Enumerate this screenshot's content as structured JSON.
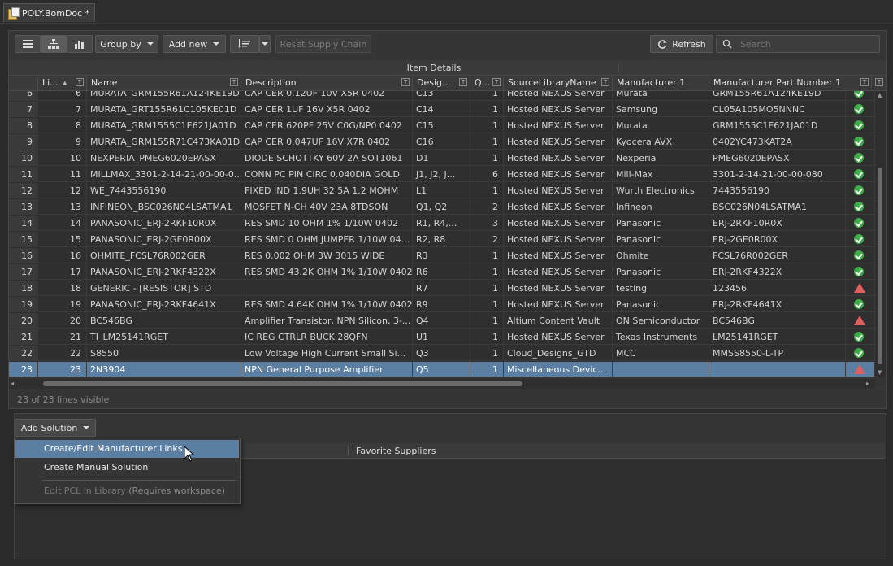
{
  "tab": {
    "title": "POLY.BomDoc *"
  },
  "toolbar": {
    "group_by": "Group by",
    "add_new": "Add new",
    "reset_supply_chain": "Reset Supply Chain",
    "refresh": "Refresh",
    "search_placeholder": "Search"
  },
  "grid": {
    "group_header": "Item Details",
    "columns": [
      "Li...",
      "Name",
      "Description",
      "Desig...",
      "Q...",
      "SourceLibraryName",
      "Manufacturer 1",
      "Manufacturer Part Number 1"
    ],
    "rows": [
      {
        "rn": "6",
        "line": "6",
        "name": "MURATA_GRM155R61A124KE19D",
        "desc": "CAP CER 0.12UF 10V X5R 0402",
        "des": "C13",
        "qty": "1",
        "src": "Hosted NEXUS Server",
        "mfr": "Murata",
        "mpn": "GRM155R61A124KE19D",
        "status": "ok"
      },
      {
        "rn": "7",
        "line": "7",
        "name": "MURATA_GRT155R61C105KE01D",
        "desc": "CAP CER 1UF 16V X5R 0402",
        "des": "C14",
        "qty": "1",
        "src": "Hosted NEXUS Server",
        "mfr": "Samsung",
        "mpn": "CL05A105MO5NNNC",
        "status": "ok"
      },
      {
        "rn": "8",
        "line": "8",
        "name": "MURATA_GRM1555C1E621JA01D",
        "desc": "CAP CER 620PF 25V C0G/NP0 0402",
        "des": "C15",
        "qty": "1",
        "src": "Hosted NEXUS Server",
        "mfr": "Murata",
        "mpn": "GRM1555C1E621JA01D",
        "status": "ok"
      },
      {
        "rn": "9",
        "line": "9",
        "name": "MURATA_GRM155R71C473KA01D",
        "desc": "CAP CER 0.047UF 16V X7R 0402",
        "des": "C16",
        "qty": "1",
        "src": "Hosted NEXUS Server",
        "mfr": "Kyocera AVX",
        "mpn": "0402YC473KAT2A",
        "status": "ok"
      },
      {
        "rn": "10",
        "line": "10",
        "name": "NEXPERIA_PMEG6020EPASX",
        "desc": "DIODE SCHOTTKY 60V 2A SOT1061",
        "des": "D1",
        "qty": "1",
        "src": "Hosted NEXUS Server",
        "mfr": "Nexperia",
        "mpn": "PMEG6020EPASX",
        "status": "ok"
      },
      {
        "rn": "11",
        "line": "11",
        "name": "MILLMAX_3301-2-14-21-00-00-0...",
        "desc": "CONN PC PIN CIRC 0.040DIA GOLD",
        "des": "J1, J2, J...",
        "qty": "6",
        "src": "Hosted NEXUS Server",
        "mfr": "Mill-Max",
        "mpn": "3301-2-14-21-00-00-080",
        "status": "ok"
      },
      {
        "rn": "12",
        "line": "12",
        "name": "WE_7443556190",
        "desc": "FIXED IND 1.9UH 32.5A 1.2 MOHM",
        "des": "L1",
        "qty": "1",
        "src": "Hosted NEXUS Server",
        "mfr": "Wurth Electronics",
        "mpn": "7443556190",
        "status": "ok"
      },
      {
        "rn": "13",
        "line": "13",
        "name": "INFINEON_BSC026N04LSATMA1",
        "desc": "MOSFET N-CH 40V 23A 8TDSON",
        "des": "Q1, Q2",
        "qty": "2",
        "src": "Hosted NEXUS Server",
        "mfr": "Infineon",
        "mpn": "BSC026N04LSATMA1",
        "status": "ok"
      },
      {
        "rn": "14",
        "line": "14",
        "name": "PANASONIC_ERJ-2RKF10R0X",
        "desc": "RES SMD 10 OHM 1% 1/10W 0402",
        "des": "R1, R4,...",
        "qty": "3",
        "src": "Hosted NEXUS Server",
        "mfr": "Panasonic",
        "mpn": "ERJ-2RKF10R0X",
        "status": "ok"
      },
      {
        "rn": "15",
        "line": "15",
        "name": "PANASONIC_ERJ-2GE0R00X",
        "desc": "RES SMD 0 OHM JUMPER 1/10W 04...",
        "des": "R2, R8",
        "qty": "2",
        "src": "Hosted NEXUS Server",
        "mfr": "Panasonic",
        "mpn": "ERJ-2GE0R00X",
        "status": "ok"
      },
      {
        "rn": "16",
        "line": "16",
        "name": "OHMITE_FCSL76R002GER",
        "desc": "RES 0.002 OHM 3W 3015 WIDE",
        "des": "R3",
        "qty": "1",
        "src": "Hosted NEXUS Server",
        "mfr": "Ohmite",
        "mpn": "FCSL76R002GER",
        "status": "ok"
      },
      {
        "rn": "17",
        "line": "17",
        "name": "PANASONIC_ERJ-2RKF4322X",
        "desc": "RES SMD 43.2K OHM 1% 1/10W 0402",
        "des": "R6",
        "qty": "1",
        "src": "Hosted NEXUS Server",
        "mfr": "Panasonic",
        "mpn": "ERJ-2RKF4322X",
        "status": "ok"
      },
      {
        "rn": "18",
        "line": "18",
        "name": "GENERIC - [RESISTOR] STD",
        "desc": "",
        "des": "R7",
        "qty": "1",
        "src": "Hosted NEXUS Server",
        "mfr": "testing",
        "mpn": "123456",
        "status": "warn"
      },
      {
        "rn": "19",
        "line": "19",
        "name": "PANASONIC_ERJ-2RKF4641X",
        "desc": "RES SMD 4.64K OHM 1% 1/10W 0402",
        "des": "R9",
        "qty": "1",
        "src": "Hosted NEXUS Server",
        "mfr": "Panasonic",
        "mpn": "ERJ-2RKF4641X",
        "status": "ok"
      },
      {
        "rn": "20",
        "line": "20",
        "name": "BC546BG",
        "desc": "Amplifier Transistor, NPN Silicon, 3-...",
        "des": "Q4",
        "qty": "1",
        "src": "Altium Content Vault",
        "mfr": "ON Semiconductor",
        "mpn": "BC546BG",
        "status": "warn"
      },
      {
        "rn": "21",
        "line": "21",
        "name": "TI_LM25141RGET",
        "desc": "IC REG CTRLR BUCK 28QFN",
        "des": "U1",
        "qty": "1",
        "src": "Hosted NEXUS Server",
        "mfr": "Texas Instruments",
        "mpn": "LM25141RGET",
        "status": "ok"
      },
      {
        "rn": "22",
        "line": "22",
        "name": "S8550",
        "desc": "Low Voltage High Current Small Si...",
        "des": "Q3",
        "qty": "1",
        "src": "Cloud_Designs_GTD",
        "mfr": "MCC",
        "mpn": "MMSS8550-L-TP",
        "status": "ok"
      },
      {
        "rn": "23",
        "line": "23",
        "name": "2N3904",
        "desc": "NPN General Purpose Amplifier",
        "des": "Q5",
        "qty": "1",
        "src": "Miscellaneous Devic...",
        "mfr": "",
        "mpn": "",
        "status": "warn",
        "selected": true
      }
    ],
    "status_text": "23 of 23 lines visible"
  },
  "lower": {
    "add_solution": "Add Solution",
    "favorite_suppliers": "Favorite Suppliers"
  },
  "menu": {
    "item1": "Create/Edit Manufacturer Links",
    "item2": "Create Manual Solution",
    "item3": "Edit PCL in Library",
    "item3_note": "(Requires workspace)"
  },
  "colors": {
    "accent": "#5b7fa3",
    "ok": "#3fae49",
    "warn": "#e06060"
  }
}
